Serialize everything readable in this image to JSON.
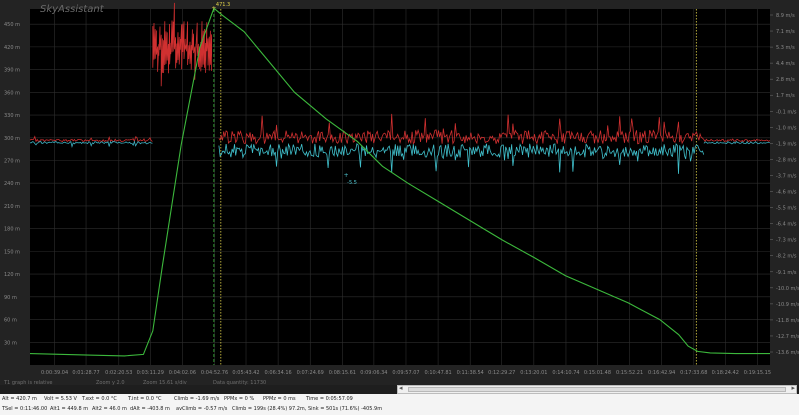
{
  "app_title": "SkyAssistant",
  "chart_data": {
    "type": "line",
    "title": "SkyAssistant",
    "y_left_ticks": [
      "450 m",
      "420 m",
      "390 m",
      "360 m",
      "330 m",
      "300 m",
      "270 m",
      "240 m",
      "210 m",
      "180 m",
      "150 m",
      "120 m",
      "90 m",
      "60 m",
      "30 m"
    ],
    "y_left_range": [
      0,
      470
    ],
    "y_right_ticks": [
      "8.9 m/s",
      "7.1 m/s",
      "5.3 m/s",
      "4.4 m/s",
      "2.8 m/s",
      "1.7 m/s",
      "-0.1 m/s",
      "-1.0 m/s",
      "-1.9 m/s",
      "-2.8 m/s",
      "-3.7 m/s",
      "-4.6 m/s",
      "-5.5 m/s",
      "-6.4 m/s",
      "-7.3 m/s",
      "-8.2 m/s",
      "-9.1 m/s",
      "-10.0 m/s",
      "-10.9 m/s",
      "-11.8 m/s",
      "-12.7 m/s",
      "-13.6 m/s"
    ],
    "x_ticks": [
      "0:00:39.04",
      "0:01:28.77",
      "0:02:20.53",
      "0:03:11.29",
      "0:04:02.06",
      "0:04:52.76",
      "0:05:43.42",
      "0:06:34.16",
      "0:07:24.69",
      "0:08:15.61",
      "0:09:06.34",
      "0:09:57.07",
      "0:10:47.81",
      "0:11:38.54",
      "0:12:29.27",
      "0:13:20.01",
      "0:14:10.74",
      "0:15:01.48",
      "0:15:52.21",
      "0:16:42.94",
      "0:17:33.68",
      "0:18:24.42",
      "0:19:15.15"
    ],
    "x_ticks_sec": [
      39,
      89,
      141,
      191,
      242,
      293,
      343,
      394,
      445,
      496,
      546,
      597,
      648,
      699,
      749,
      800,
      851,
      901,
      952,
      1003,
      1054,
      1104,
      1155
    ],
    "altitude_series": {
      "name": "Alt",
      "color": "#3cb83c",
      "x": [
        0,
        100,
        150,
        180,
        195,
        210,
        240,
        270,
        292,
        305,
        340,
        380,
        420,
        470,
        520,
        560,
        600,
        650,
        700,
        750,
        800,
        850,
        900,
        950,
        1000,
        1030,
        1045,
        1060,
        1080,
        1120,
        1160,
        1175
      ],
      "y": [
        15,
        13,
        12,
        14,
        45,
        130,
        290,
        420,
        471,
        462,
        440,
        400,
        360,
        325,
        295,
        262,
        240,
        215,
        190,
        165,
        142,
        118,
        100,
        82,
        60,
        40,
        25,
        18,
        16,
        15,
        15,
        15
      ]
    },
    "vario_segments": [
      {
        "name": "level-start",
        "x_range": [
          0,
          195
        ],
        "base": 295,
        "amp": 3,
        "colors": [
          "#d03030",
          "#3cb0c0"
        ]
      },
      {
        "name": "climb",
        "x_range": [
          195,
          290
        ],
        "base": 420,
        "amp": 35,
        "colors": [
          "#d03030"
        ]
      },
      {
        "name": "descent",
        "x_range": [
          300,
          1070
        ],
        "base": 292,
        "amp": 18,
        "colors": [
          "#d03030",
          "#40c0cc"
        ]
      },
      {
        "name": "level-end",
        "x_range": [
          1070,
          1175
        ],
        "base": 295,
        "amp": 3,
        "colors": [
          "#d03030",
          "#3cb0c0"
        ]
      }
    ],
    "vline_yellow_dotted_x": [
      303,
      1058
    ],
    "vline_green_dashed_x": [
      292
    ],
    "peak_label": "471.3",
    "peak_x": 292,
    "min_label": "-5.5",
    "min_x": 502,
    "grid": true,
    "legend": "none"
  },
  "status_bar": {
    "graph_mode": "T1 graph is relative",
    "zoom_y": "Zoom y 2.0",
    "zoom_x": "Zoom 15.61 s/div",
    "data_quantity": "Data quantity: 11730"
  },
  "info_bar": {
    "alt": "Alt = 420.7 m",
    "volt": "Volt = 5.53 V",
    "text": "T.ext = 0.0 °C",
    "tint": "T.int = 0.0 °C",
    "climb": "Climb = -1.69 m/s",
    "ppmx": "PPMx = 0 %",
    "ppmz": "PPMz = 0 ms",
    "time": "Time = 0:05:57.09",
    "tsel": "TSel = 0:11:46.00",
    "alt1": "Alt1 = 449.8 m",
    "alt2": "Alt2 = 46.0 m",
    "dalt": "dAlt = -403.8 m",
    "avclimb": "avClimb = -0.57 m/s",
    "climb_stats": "Climb = 199s (28.4%) 97.2m, Sink = 501s (71.6%) -405.9m"
  }
}
